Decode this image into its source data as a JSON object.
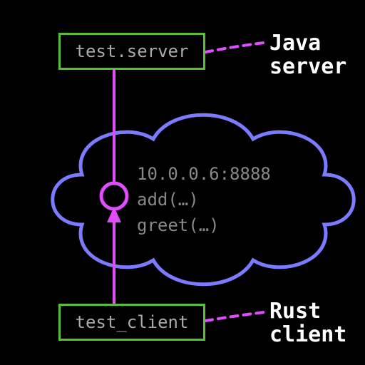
{
  "server_box": {
    "text": "test.server"
  },
  "server_label_line1": "Java",
  "server_label_line2": "server",
  "cloud": {
    "address": "10.0.0.6:8888",
    "method1": "add(…)",
    "method2": "greet(…)"
  },
  "client_box": {
    "text": "test_client"
  },
  "client_label_line1": "Rust",
  "client_label_line2": "client",
  "colors": {
    "box_border": "#57c038",
    "cloud_stroke": "#7a7bff",
    "connector": "#e24cff",
    "dashed": "#e24cff",
    "text_muted": "#888"
  }
}
